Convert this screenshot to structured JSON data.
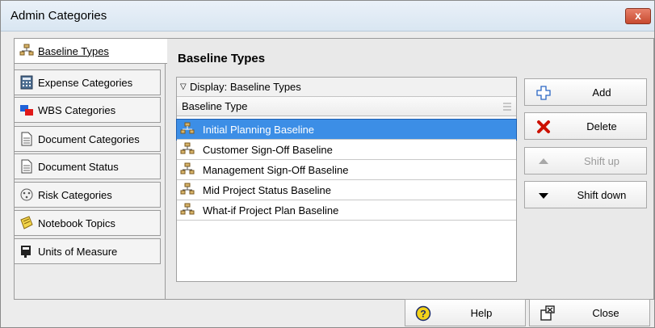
{
  "window": {
    "title": "Admin Categories",
    "close_glyph": "x"
  },
  "tabs": [
    {
      "label": "Baseline Types",
      "icon": "baseline-icon",
      "active": true
    },
    {
      "label": "Expense Categories",
      "icon": "calculator-icon"
    },
    {
      "label": "WBS Categories",
      "icon": "wbs-icon"
    },
    {
      "label": "Document Categories",
      "icon": "document-icon"
    },
    {
      "label": "Document Status",
      "icon": "document-icon"
    },
    {
      "label": "Risk Categories",
      "icon": "risk-icon"
    },
    {
      "label": "Notebook Topics",
      "icon": "notebook-icon"
    },
    {
      "label": "Units of Measure",
      "icon": "units-icon"
    }
  ],
  "main": {
    "title": "Baseline Types",
    "display_label": "Display: Baseline Types",
    "column_header": "Baseline Type",
    "rows": [
      "Initial Planning Baseline",
      "Customer Sign-Off Baseline",
      "Management Sign-Off Baseline",
      "Mid Project Status Baseline",
      "What-if Project Plan Baseline"
    ]
  },
  "actions": {
    "add": "Add",
    "delete": "Delete",
    "shift_up": "Shift up",
    "shift_down": "Shift down"
  },
  "footer": {
    "help": "Help",
    "close": "Close"
  },
  "colors": {
    "selection": "#3c8ee6",
    "panel": "#e9e9e9",
    "delete_red": "#cc1100"
  }
}
